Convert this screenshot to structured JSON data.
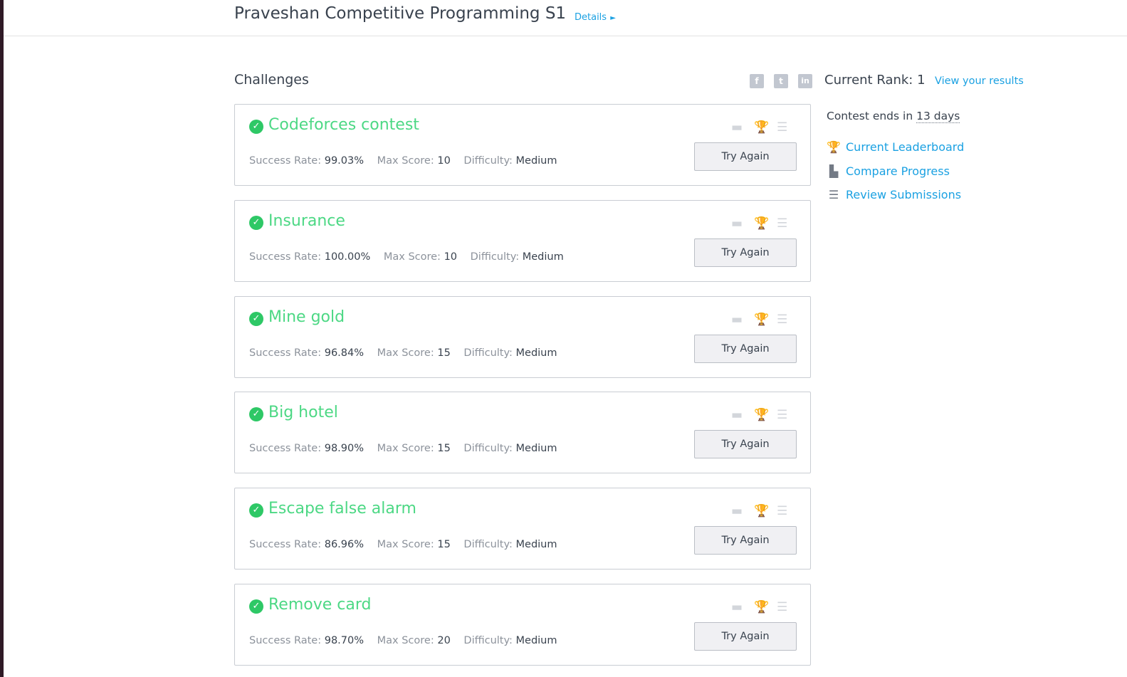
{
  "header": {
    "title": "Praveshan Competitive Programming S1",
    "details_label": "Details",
    "details_arrow": "►"
  },
  "challenges_heading": "Challenges",
  "social": {
    "facebook": "f",
    "twitter": "t",
    "linkedin": "in"
  },
  "challenges": [
    {
      "title": "Codeforces contest",
      "success_label": "Success Rate:",
      "success": "99.03%",
      "score_label": "Max Score:",
      "score": "10",
      "difficulty_label": "Difficulty:",
      "difficulty": "Medium",
      "button": "Try Again"
    },
    {
      "title": "Insurance",
      "success_label": "Success Rate:",
      "success": "100.00%",
      "score_label": "Max Score:",
      "score": "10",
      "difficulty_label": "Difficulty:",
      "difficulty": "Medium",
      "button": "Try Again"
    },
    {
      "title": "Mine gold",
      "success_label": "Success Rate:",
      "success": "96.84%",
      "score_label": "Max Score:",
      "score": "15",
      "difficulty_label": "Difficulty:",
      "difficulty": "Medium",
      "button": "Try Again"
    },
    {
      "title": "Big hotel",
      "success_label": "Success Rate:",
      "success": "98.90%",
      "score_label": "Max Score:",
      "score": "15",
      "difficulty_label": "Difficulty:",
      "difficulty": "Medium",
      "button": "Try Again"
    },
    {
      "title": "Escape false alarm",
      "success_label": "Success Rate:",
      "success": "86.96%",
      "score_label": "Max Score:",
      "score": "15",
      "difficulty_label": "Difficulty:",
      "difficulty": "Medium",
      "button": "Try Again"
    },
    {
      "title": "Remove card",
      "success_label": "Success Rate:",
      "success": "98.70%",
      "score_label": "Max Score:",
      "score": "20",
      "difficulty_label": "Difficulty:",
      "difficulty": "Medium",
      "button": "Try Again"
    }
  ],
  "sidebar": {
    "rank_label": "Current Rank: 1",
    "view_results": "View your results",
    "contest_ends_prefix": "Contest ends in",
    "contest_ends_value": "13 days",
    "links": [
      {
        "label": "Current Leaderboard",
        "icon": "trophy-icon"
      },
      {
        "label": "Compare Progress",
        "icon": "bar-chart-icon"
      },
      {
        "label": "Review Submissions",
        "icon": "list-icon"
      }
    ]
  },
  "colors": {
    "accent": "#1ba1e2",
    "success": "#2ec866",
    "title_green": "#4cd884",
    "text": "#39424e",
    "muted": "#8c929b"
  }
}
